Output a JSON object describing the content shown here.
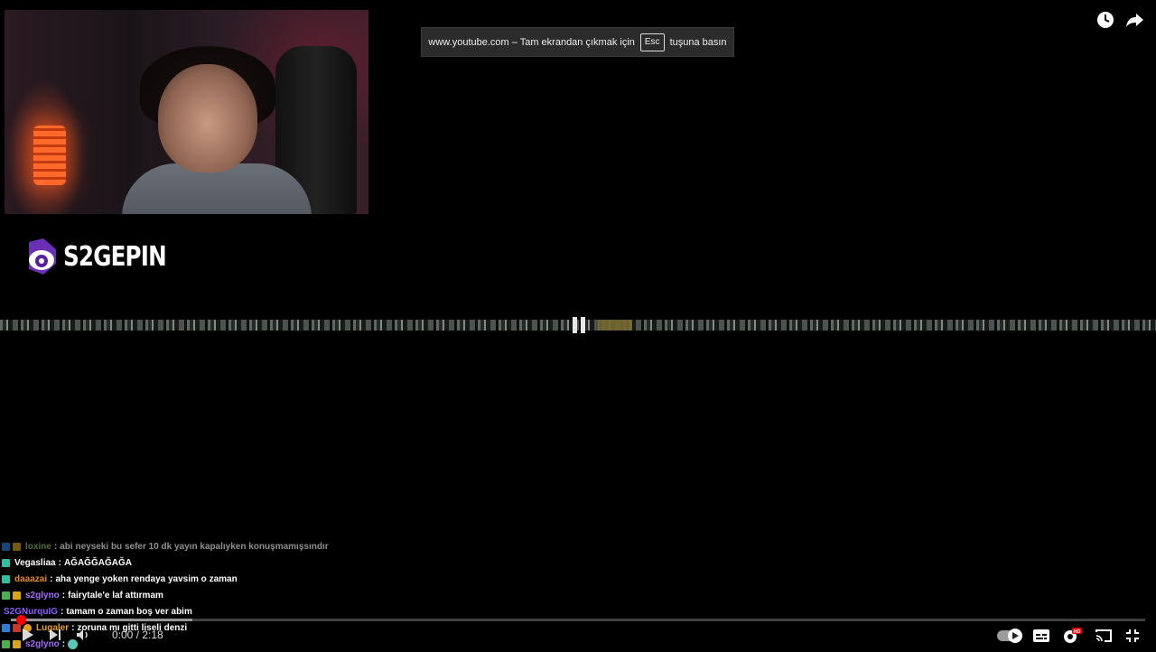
{
  "fullscreen_notice": {
    "prefix": "www.youtube.com – Tam ekrandan çıkmak için",
    "key": "Esc",
    "suffix": "tuşuna basın"
  },
  "logo": {
    "text": "S2GEPIN"
  },
  "chat": [
    {
      "user": "loxine",
      "message": "abi neyseki bu sefer 10 dk yayın kapalıyken konuşmamışsındır",
      "color": "#8ec66a",
      "faded": true
    },
    {
      "user": "Vegasliaa",
      "message": "AĞAĞĞAĞAĞA",
      "color": "#ffffff",
      "faded": false
    },
    {
      "user": "daaazai",
      "message": "aha yenge yoken rendaya yavsim o zaman",
      "color": "#e48a2a",
      "faded": false
    },
    {
      "user": "s2glyno",
      "message": "fairytale'e laf attırmam",
      "color": "#a66bff",
      "faded": false
    },
    {
      "user": "S2GNurquIG",
      "message": "tamam o zaman boş ver abim",
      "color": "#8a5cff",
      "faded": false
    },
    {
      "user": "Lugaler",
      "message": "zoruna mı gitti liseli denzi",
      "color": "#e6a020",
      "faded": false
    },
    {
      "user": "s2glyno",
      "message": "",
      "color": "#a66bff",
      "faded": false
    }
  ],
  "player": {
    "time": "0:00 / 2:18",
    "progress": 0,
    "buffered": 0.16
  },
  "icons": {
    "watch_later": "clock-icon",
    "share": "share-icon",
    "play": "play-icon",
    "next": "next-icon",
    "volume": "volume-icon",
    "autoplay": "autoplay-toggle",
    "subtitles": "subtitles-icon",
    "settings": "settings-gear-icon",
    "cast": "cast-icon",
    "exit_fullscreen": "exit-fullscreen-icon"
  }
}
